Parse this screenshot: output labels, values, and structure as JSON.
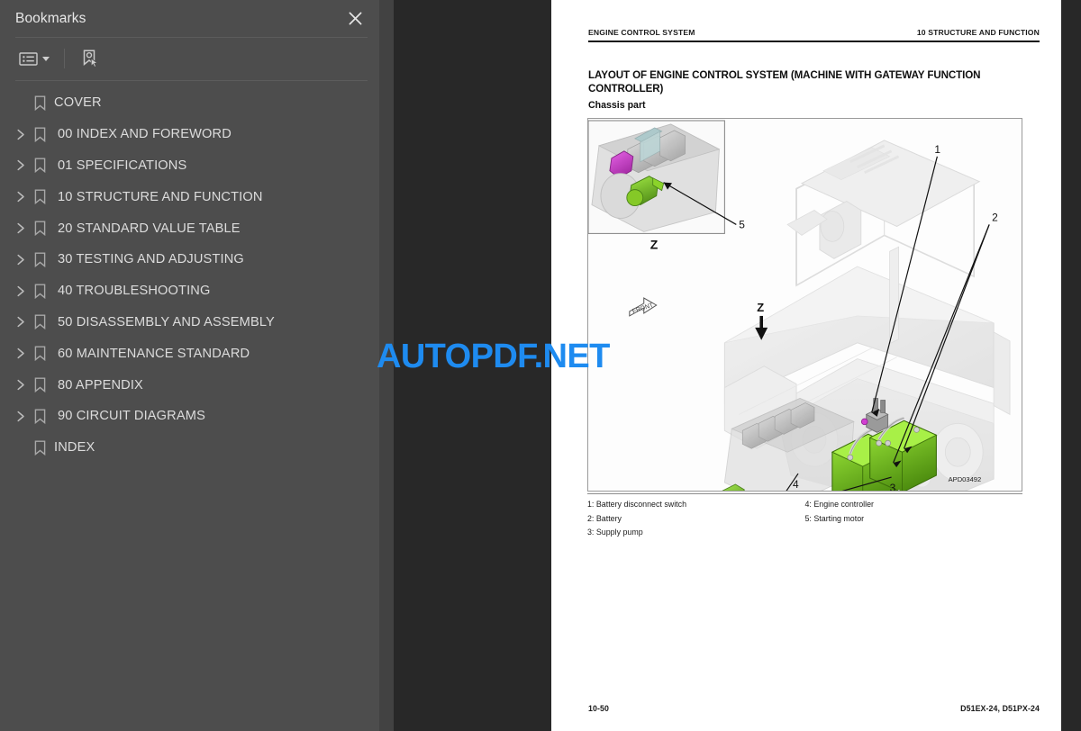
{
  "sidebar": {
    "title": "Bookmarks",
    "close_icon": "close-icon",
    "toolbar": {
      "list_options_icon": "list-options-icon",
      "list_options_caret_icon": "chevron-down-icon",
      "current_bookmark_icon": "bookmark-cursor-icon"
    },
    "items": [
      {
        "label": "COVER",
        "expandable": false
      },
      {
        "label": "00 INDEX AND FOREWORD",
        "expandable": true
      },
      {
        "label": "01 SPECIFICATIONS",
        "expandable": true
      },
      {
        "label": "10 STRUCTURE AND FUNCTION",
        "expandable": true
      },
      {
        "label": "20 STANDARD VALUE TABLE",
        "expandable": true
      },
      {
        "label": "30 TESTING AND ADJUSTING",
        "expandable": true
      },
      {
        "label": "40 TROUBLESHOOTING",
        "expandable": true
      },
      {
        "label": "50 DISASSEMBLY AND ASSEMBLY",
        "expandable": true
      },
      {
        "label": "60 MAINTENANCE STANDARD",
        "expandable": true
      },
      {
        "label": "80 APPENDIX",
        "expandable": true
      },
      {
        "label": "90 CIRCUIT DIAGRAMS",
        "expandable": true
      },
      {
        "label": "INDEX",
        "expandable": false
      }
    ]
  },
  "watermark": {
    "text_1": "AUTOPDF",
    "text_2": ".NET",
    "color": "#1e8bf0"
  },
  "page": {
    "header_left": "ENGINE CONTROL SYSTEM",
    "header_right": "10 STRUCTURE AND FUNCTION",
    "title": "LAYOUT OF ENGINE CONTROL SYSTEM (MACHINE WITH GATEWAY FUNCTION CONTROLLER)",
    "subtitle": "Chassis part",
    "footer_left": "10-50",
    "footer_right": "D51EX-24, D51PX-24",
    "figure": {
      "figure_id": "APD03492",
      "detail_view_label": "Z",
      "section_arrow_label": "Z",
      "orientation_marker": "FRONT",
      "callouts": [
        "1",
        "2",
        "3",
        "4",
        "5"
      ],
      "highlight_colors": {
        "battery_green": "#7ed321",
        "battery_green_dark": "#5ba015",
        "supply_pump_magenta": "#d13fd1",
        "engine_controller_cyan": "#17b6c4",
        "machine_ghost": "#d8d8d8"
      }
    },
    "legend": {
      "column_1": [
        "1: Battery disconnect switch",
        "2: Battery",
        "3: Supply pump"
      ],
      "column_2": [
        "4: Engine controller",
        "5: Starting motor"
      ]
    }
  }
}
